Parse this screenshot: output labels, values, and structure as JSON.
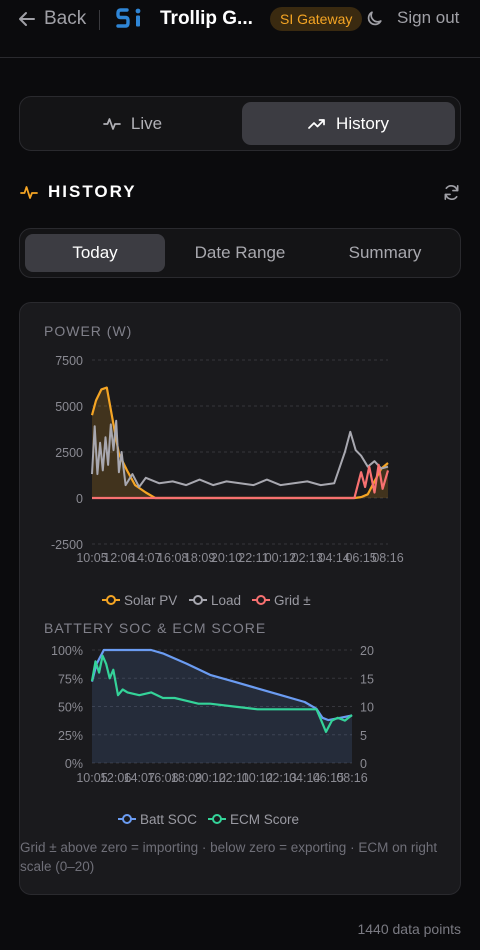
{
  "header": {
    "back_label": "Back",
    "app_title": "Trollip G...",
    "site_badge": "SI Gateway",
    "signout_label": "Sign out",
    "accent_color": "#f5a524"
  },
  "mode_tabs": {
    "live_label": "Live",
    "history_label": "History",
    "selected": "History"
  },
  "section": {
    "title": "HISTORY"
  },
  "range_tabs": {
    "today_label": "Today",
    "date_range_label": "Date Range",
    "summary_label": "Summary",
    "selected": "Today"
  },
  "power_chart": {
    "title": "POWER (W)"
  },
  "battery_chart": {
    "title": "BATTERY SOC & ECM SCORE"
  },
  "footnote": "Grid ± above zero = importing · below zero = exporting · ECM on right scale (0–20)",
  "data_points_label": "1440 data points",
  "chart_data": [
    {
      "type": "line",
      "title": "POWER (W)",
      "x_ticks": [
        "10:05",
        "12:06",
        "14:07",
        "16:08",
        "18:09",
        "20:10",
        "22:11",
        "00:12",
        "02:13",
        "04:14",
        "06:15",
        "08:16"
      ],
      "y_ticks": [
        7500,
        5000,
        2500,
        0,
        -2500
      ],
      "ylim": [
        -2500,
        7500
      ],
      "legend_position": "bottom",
      "series": [
        {
          "name": "Solar PV",
          "color": "#f5a524",
          "x": [
            0,
            0.3,
            0.7,
            1.1,
            1.6,
            2.0,
            2.6,
            3.2,
            4.0,
            4.7,
            5.0,
            5.5,
            6.0,
            8.0,
            10.0,
            12.0,
            14.0,
            16.0,
            18.0,
            19.5,
            20.0,
            20.5,
            21.0,
            21.5,
            22.0
          ],
          "values": [
            4500,
            5300,
            5900,
            6000,
            4000,
            2400,
            1500,
            700,
            300,
            0,
            0,
            0,
            0,
            0,
            0,
            0,
            0,
            0,
            0,
            0,
            50,
            200,
            900,
            1600,
            1900
          ]
        },
        {
          "name": "Load",
          "color": "#a8a8b0",
          "x": [
            0,
            0.2,
            0.4,
            0.6,
            0.8,
            1.0,
            1.2,
            1.4,
            1.6,
            1.8,
            2.0,
            2.2,
            2.5,
            3.0,
            3.5,
            4.0,
            5.0,
            6.0,
            7.0,
            8.0,
            9.0,
            10.0,
            11.0,
            12.0,
            13.0,
            14.0,
            15.0,
            16.0,
            17.0,
            18.0,
            18.8,
            19.2,
            19.6,
            20.0,
            20.5,
            21.0,
            21.5,
            22.0
          ],
          "values": [
            1300,
            3900,
            1300,
            3000,
            1500,
            3300,
            1800,
            4000,
            2600,
            4200,
            1400,
            2500,
            700,
            1300,
            600,
            1100,
            800,
            900,
            700,
            1000,
            700,
            900,
            800,
            700,
            1000,
            700,
            800,
            900,
            700,
            800,
            2500,
            3600,
            2600,
            2300,
            1700,
            2000,
            1600,
            1700
          ]
        },
        {
          "name": "Grid ±",
          "color": "#f87171",
          "x": [
            0,
            2,
            4,
            6,
            8,
            10,
            12,
            14,
            16,
            18,
            19.5,
            20.0,
            20.3,
            20.6,
            21.0,
            21.3,
            21.6,
            22.0
          ],
          "values": [
            0,
            0,
            0,
            0,
            0,
            0,
            0,
            0,
            0,
            0,
            0,
            1400,
            600,
            1700,
            300,
            1800,
            500,
            1500
          ]
        }
      ]
    },
    {
      "type": "line",
      "title": "BATTERY SOC & ECM SCORE",
      "x_ticks": [
        "10:05",
        "12:06",
        "14:07",
        "16:08",
        "18:09",
        "20:10",
        "22:11",
        "00:12",
        "02:13",
        "04:14",
        "06:15",
        "08:16"
      ],
      "y_left_ticks": [
        "100%",
        "75%",
        "50%",
        "25%",
        "0%"
      ],
      "y_right_ticks": [
        20,
        15,
        10,
        5,
        0
      ],
      "legend_position": "bottom",
      "series": [
        {
          "name": "Batt SOC",
          "color": "#6b9cf2",
          "axis": "left",
          "x": [
            0,
            0.4,
            0.8,
            1.0,
            1.4,
            2.0,
            3.0,
            4.0,
            5.0,
            6.0,
            8.0,
            10.0,
            12.0,
            14.0,
            16.0,
            18.0,
            19.0,
            19.5,
            20.0,
            21.0,
            22.0
          ],
          "values": [
            72,
            88,
            96,
            100,
            100,
            100,
            100,
            100,
            100,
            97,
            88,
            78,
            72,
            66,
            60,
            54,
            48,
            40,
            38,
            40,
            42
          ]
        },
        {
          "name": "ECM Score",
          "color": "#34d399",
          "axis": "right",
          "x": [
            0,
            0.3,
            0.6,
            0.9,
            1.2,
            1.5,
            1.8,
            2.2,
            2.6,
            3.0,
            4.0,
            5.0,
            6.0,
            7.0,
            8.0,
            9.0,
            10.0,
            12.0,
            14.0,
            16.0,
            18.0,
            19.0,
            19.4,
            19.8,
            20.3,
            20.8,
            21.4,
            22.0
          ],
          "values": [
            14.5,
            18,
            16,
            19,
            17.5,
            15,
            16.5,
            12,
            13,
            12.5,
            12,
            12.5,
            11.5,
            11.5,
            11,
            10.5,
            10.5,
            10,
            9.5,
            9.5,
            9.5,
            9.5,
            7.5,
            5.5,
            7.5,
            8,
            7.5,
            8.5
          ]
        }
      ]
    }
  ]
}
